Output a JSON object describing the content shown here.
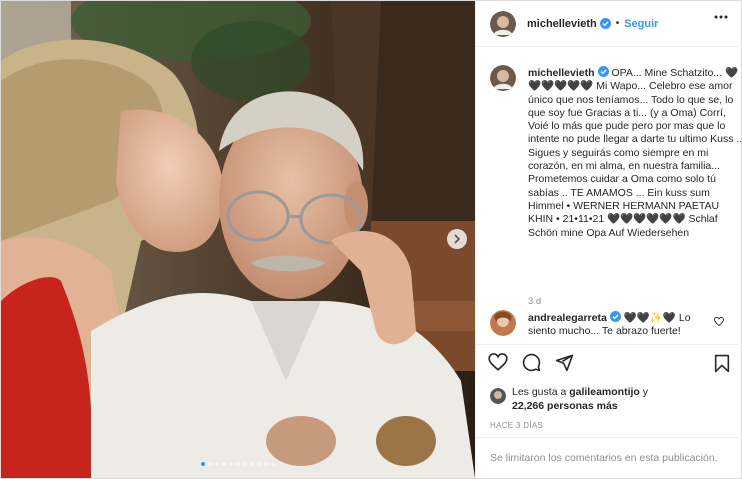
{
  "post": {
    "author": {
      "username": "michellevieth",
      "verified": true,
      "follow_label": "Seguir",
      "separator": "•"
    },
    "caption": {
      "username": "michellevieth",
      "text": " OPA... Mine Schatzito... 🖤🖤🖤🖤🖤🖤 Mi Wapo... Celebro ese amor único que nos teníamos... Todo lo que se, lo que soy fue Gracias a ti... (y a Oma) Corrí, Voié lo más que pude pero por mas que lo intente no pude llegar a darte tu ultimo Kuss ... Sigues y seguirás como siempre en mi corazón, en mi alma, en nuestra familia... Prometemos cuidar a Oma como solo tú sabías .. TE AMAMOS ... Ein kuss sum Himmel • WERNER HERMANN PAETAU KHIN • 21•11•21 🖤🖤🖤🖤🖤🖤 Schlaf Schön mine Opa Auf Wiedersehen",
      "time": "3 d"
    },
    "comment": {
      "username": "andrealegarreta",
      "verified": true,
      "text": " 🖤🖤✨🖤 Lo siento mucho... Te abrazo fuerte!"
    },
    "likes": {
      "prefix": "Les gusta a ",
      "user": "galileamontijo",
      "connector": " y",
      "count": "22,266 personas más"
    },
    "date": "HACE 3 DÍAS",
    "comments_disabled": "Se limitaron los comentarios en esta publicación.",
    "carousel": {
      "total": 11,
      "active_index": 0
    }
  },
  "icons": [
    "more-icon",
    "verified-icon",
    "heart-icon",
    "comment-icon",
    "share-icon",
    "save-icon",
    "chevron-right-icon"
  ],
  "colors": {
    "link": "#3897f0",
    "muted": "#8e8e8e",
    "border": "#efefef",
    "text": "#262626"
  }
}
